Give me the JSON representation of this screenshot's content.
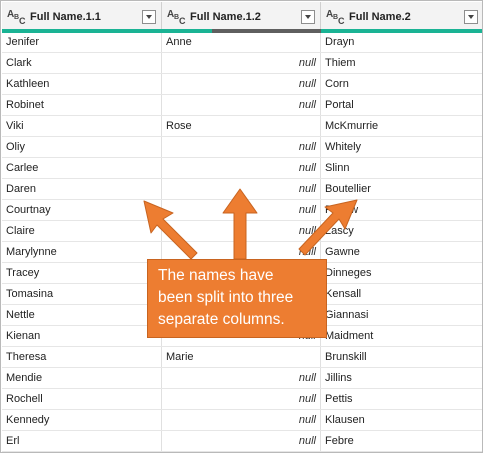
{
  "columns": [
    {
      "title": "Full Name.1.1",
      "type_icon": "text-type-icon",
      "quality_color": "#1ab394"
    },
    {
      "title": "Full Name.1.2",
      "type_icon": "text-type-icon",
      "quality_color": "#5f5f5f"
    },
    {
      "title": "Full Name.2",
      "type_icon": "text-type-icon",
      "quality_color": "#1ab394"
    }
  ],
  "type_glyph": {
    "a": "A",
    "b": "B",
    "c": "C"
  },
  "rows": [
    [
      "Jenifer",
      "Anne",
      "Drayn"
    ],
    [
      "Clark",
      "null",
      "Thiem"
    ],
    [
      "Kathleen",
      "null",
      "Corn"
    ],
    [
      "Robinet",
      "null",
      "Portal"
    ],
    [
      "Viki",
      "Rose",
      "McKmurrie"
    ],
    [
      "Oliy",
      "null",
      "Whitely"
    ],
    [
      "Carlee",
      "null",
      "Slinn"
    ],
    [
      "Daren",
      "null",
      "Boutellier"
    ],
    [
      "Courtnay",
      "null",
      "Pexow"
    ],
    [
      "Claire",
      "null",
      "Lascy"
    ],
    [
      "Marylynne",
      "null",
      "Gawne"
    ],
    [
      "Tracey",
      "null",
      "Dinneges"
    ],
    [
      "Tomasina",
      "null",
      "Kensall"
    ],
    [
      "Nettle",
      "null",
      "Giannasi"
    ],
    [
      "Kienan",
      "null",
      "Maidment"
    ],
    [
      "Theresa",
      "Marie",
      "Brunskill"
    ],
    [
      "Mendie",
      "null",
      "Jillins"
    ],
    [
      "Rochell",
      "null",
      "Pettis"
    ],
    [
      "Kennedy",
      "null",
      "Klausen"
    ],
    [
      "Erl",
      "null",
      "Febre"
    ]
  ],
  "callout": {
    "lines": [
      "The names have",
      "been split into three",
      "separate columns."
    ],
    "color": "#ed7d31"
  }
}
